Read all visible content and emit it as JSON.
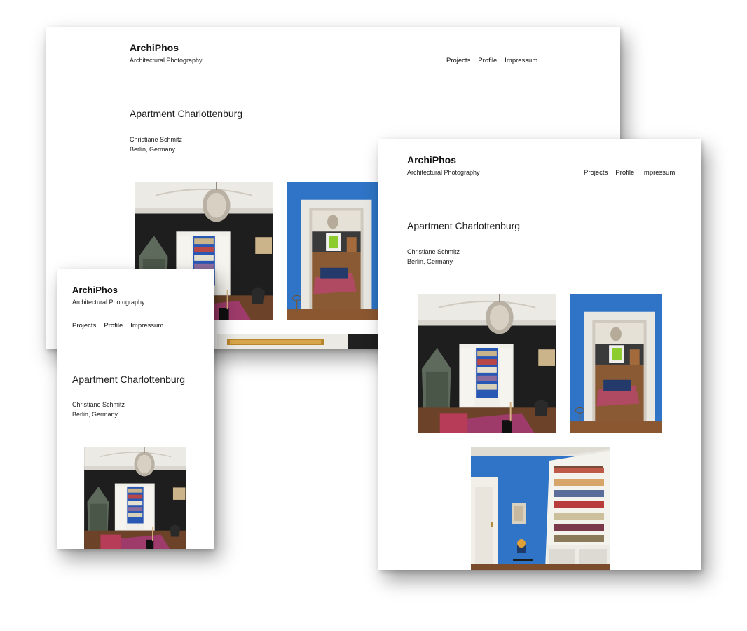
{
  "site": {
    "brand": "ArchiPhos",
    "tagline": "Architectural Photography",
    "nav": [
      "Projects",
      "Profile",
      "Impressum"
    ]
  },
  "project": {
    "title": "Apartment Charlottenburg",
    "client": "Christiane Schmitz",
    "location": "Berlin, Germany"
  },
  "colors": {
    "wall_blue": "#2f74c6",
    "wall_black": "#202020",
    "ceiling": "#ececea",
    "floor": "#7a4a2a",
    "rug": "#a23b6f"
  }
}
